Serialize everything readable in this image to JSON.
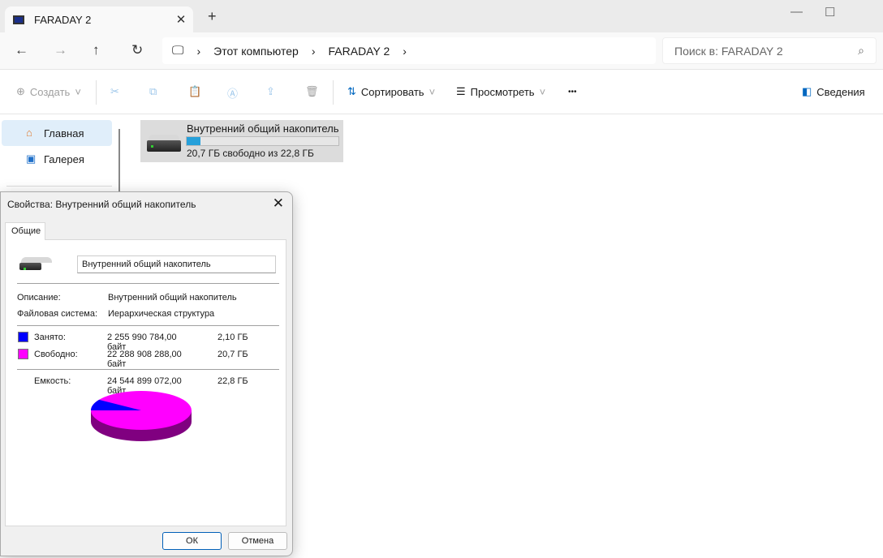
{
  "window": {
    "tab_title": "FARADAY 2"
  },
  "address": {
    "crumbs": [
      "Этот компьютер",
      "FARADAY 2"
    ],
    "search_placeholder": "Поиск в: FARADAY 2"
  },
  "toolbar": {
    "create": "Создать",
    "sort": "Сортировать",
    "view": "Просмотреть",
    "more": "•••",
    "details": "Сведения"
  },
  "sidebar": {
    "items": [
      {
        "label": "Главная",
        "icon": "home-icon",
        "selected": true
      },
      {
        "label": "Галерея",
        "icon": "gallery-icon"
      }
    ]
  },
  "drive": {
    "name": "Внутренний общий накопитель",
    "free_text": "20,7 ГБ свободно из 22,8 ГБ",
    "used_fraction": 0.092,
    "bar_color": "#26a0da"
  },
  "dialog": {
    "title": "Свойства: Внутренний общий накопитель",
    "tab": "Общие",
    "name_value": "Внутренний общий накопитель",
    "description_label": "Описание:",
    "description_value": "Внутренний общий накопитель",
    "fs_label": "Файловая система:",
    "fs_value": "Иерархическая структура",
    "used_label": "Занято:",
    "used_bytes": "2 255 990 784,00 байт",
    "used_size": "2,10 ГБ",
    "used_color": "#0000ff",
    "free_label": "Свободно:",
    "free_bytes": "22 288 908 288,00 байт",
    "free_size": "20,7 ГБ",
    "free_color": "#ff00ff",
    "capacity_label": "Емкость:",
    "capacity_bytes": "24 544 899 072,00 байт",
    "capacity_size": "22,8 ГБ",
    "ok": "ОК",
    "cancel": "Отмена"
  }
}
